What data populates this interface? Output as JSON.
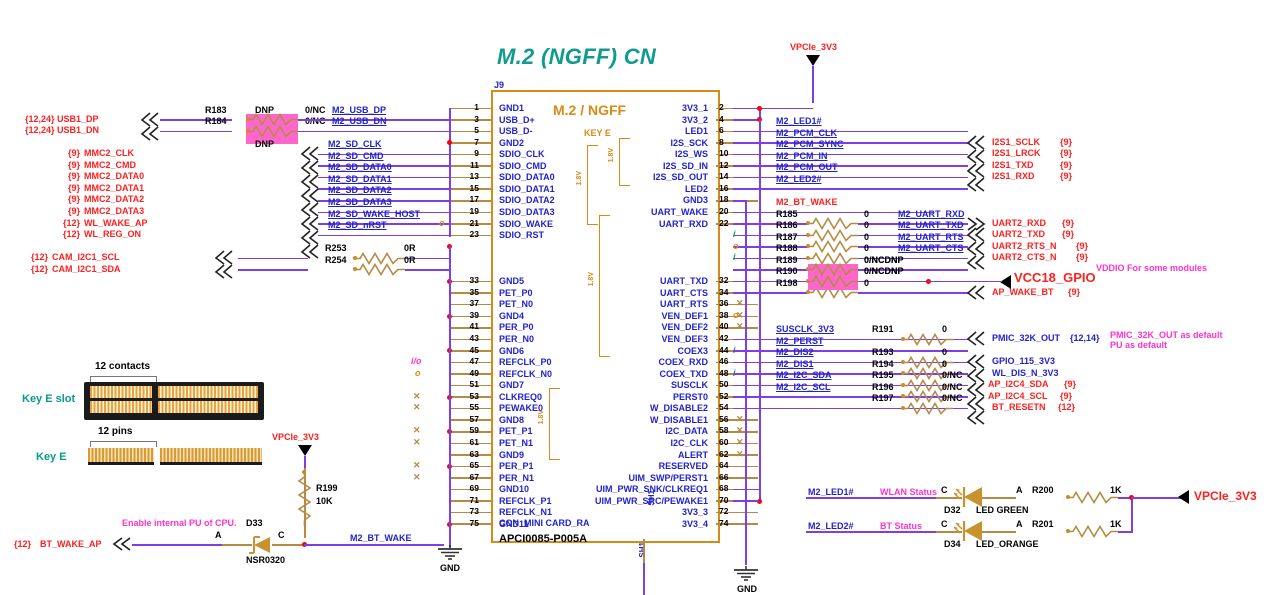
{
  "sheet": {
    "title": "M.2 (NGFF) CN",
    "connector": {
      "refdes": "J9",
      "part_label": "M.2 / NGFF",
      "key_label": "KEY E",
      "footprint": "CON_MINI CARD_RA",
      "mpn": "APCI0085-P005A",
      "shield_label": "SH1",
      "shield_label2": "SH1"
    },
    "voltage_brackets": [
      "1.8V",
      "1.8V",
      "1.8V",
      "1.8V",
      "1.8V"
    ],
    "gnd_label": "GND"
  },
  "left_pins": [
    {
      "num": "1",
      "name": "GND1"
    },
    {
      "num": "3",
      "name": "USB_D+"
    },
    {
      "num": "5",
      "name": "USB_D-"
    },
    {
      "num": "7",
      "name": "GND2"
    },
    {
      "num": "9",
      "name": "SDIO_CLK"
    },
    {
      "num": "11",
      "name": "SDIO_CMD"
    },
    {
      "num": "13",
      "name": "SDIO_DATA0"
    },
    {
      "num": "15",
      "name": "SDIO_DATA1"
    },
    {
      "num": "17",
      "name": "SDIO_DATA2"
    },
    {
      "num": "19",
      "name": "SDIO_DATA3"
    },
    {
      "num": "21",
      "name": "SDIO_WAKE"
    },
    {
      "num": "23",
      "name": "SDIO_RST"
    },
    {
      "num": "33",
      "name": "GND5"
    },
    {
      "num": "35",
      "name": "PET_P0"
    },
    {
      "num": "37",
      "name": "PET_N0"
    },
    {
      "num": "39",
      "name": "GND4"
    },
    {
      "num": "41",
      "name": "PER_P0"
    },
    {
      "num": "43",
      "name": "PER_N0"
    },
    {
      "num": "45",
      "name": "GND6"
    },
    {
      "num": "47",
      "name": "REFCLK_P0"
    },
    {
      "num": "49",
      "name": "REFCLK_N0"
    },
    {
      "num": "51",
      "name": "GND7"
    },
    {
      "num": "53",
      "name": "CLKREQ0"
    },
    {
      "num": "55",
      "name": "PEWAKE0"
    },
    {
      "num": "57",
      "name": "GND8"
    },
    {
      "num": "59",
      "name": "PET_P1"
    },
    {
      "num": "61",
      "name": "PET_N1"
    },
    {
      "num": "63",
      "name": "GND9"
    },
    {
      "num": "65",
      "name": "PER_P1"
    },
    {
      "num": "67",
      "name": "PER_N1"
    },
    {
      "num": "69",
      "name": "GND10"
    },
    {
      "num": "71",
      "name": "REFCLK_P1"
    },
    {
      "num": "73",
      "name": "REFCLK_N1"
    },
    {
      "num": "75",
      "name": "GND11"
    }
  ],
  "right_pins": [
    {
      "num": "2",
      "name": "3V3_1"
    },
    {
      "num": "4",
      "name": "3V3_2"
    },
    {
      "num": "6",
      "name": "LED1"
    },
    {
      "num": "8",
      "name": "I2S_SCK"
    },
    {
      "num": "10",
      "name": "I2S_WS"
    },
    {
      "num": "12",
      "name": "I2S_SD_IN"
    },
    {
      "num": "14",
      "name": "I2S_SD_OUT"
    },
    {
      "num": "16",
      "name": "LED2"
    },
    {
      "num": "18",
      "name": "GND3"
    },
    {
      "num": "20",
      "name": "UART_WAKE"
    },
    {
      "num": "22",
      "name": "UART_RXD"
    },
    {
      "num": "32",
      "name": "UART_TXD"
    },
    {
      "num": "34",
      "name": "UART_CTS"
    },
    {
      "num": "36",
      "name": "UART_RTS"
    },
    {
      "num": "38",
      "name": "VEN_DEF1"
    },
    {
      "num": "40",
      "name": "VEN_DEF2"
    },
    {
      "num": "42",
      "name": "VEN_DEF3"
    },
    {
      "num": "44",
      "name": "COEX3"
    },
    {
      "num": "46",
      "name": "COEX_RXD"
    },
    {
      "num": "48",
      "name": "COEX_TXD"
    },
    {
      "num": "50",
      "name": "SUSCLK"
    },
    {
      "num": "52",
      "name": "PERST0"
    },
    {
      "num": "54",
      "name": "W_DISABLE2"
    },
    {
      "num": "56",
      "name": "W_DISABLE1"
    },
    {
      "num": "58",
      "name": "I2C_DATA"
    },
    {
      "num": "60",
      "name": "I2C_CLK"
    },
    {
      "num": "62",
      "name": "ALERT"
    },
    {
      "num": "64",
      "name": "RESERVED"
    },
    {
      "num": "66",
      "name": "UIM_SWP/PERST1"
    },
    {
      "num": "68",
      "name": "UIM_PWR_SNK/CLKREQ1"
    },
    {
      "num": "70",
      "name": "UIM_PWR_SRC/PEWAKE1"
    },
    {
      "num": "72",
      "name": "3V3_3"
    },
    {
      "num": "74",
      "name": "3V3_4"
    }
  ],
  "left_nets": {
    "usb": [
      {
        "sheet": "{12,24}",
        "name": "USB1_DP"
      },
      {
        "sheet": "{12,24}",
        "name": "USB1_DN"
      }
    ],
    "mmc": [
      {
        "sheet": "{9}",
        "name": "MMC2_CLK"
      },
      {
        "sheet": "{9}",
        "name": "MMC2_CMD"
      },
      {
        "sheet": "{9}",
        "name": "MMC2_DATA0"
      },
      {
        "sheet": "{9}",
        "name": "MMC2_DATA1"
      },
      {
        "sheet": "{9}",
        "name": "MMC2_DATA2"
      },
      {
        "sheet": "{9}",
        "name": "MMC2_DATA3"
      },
      {
        "sheet": "{12}",
        "name": "WL_WAKE_AP"
      },
      {
        "sheet": "{12}",
        "name": "WL_REG_ON"
      }
    ],
    "cam": [
      {
        "sheet": "{12}",
        "name": "CAM_I2C1_SCL"
      },
      {
        "sheet": "{12}",
        "name": "CAM_I2C1_SDA"
      }
    ],
    "bt_wake_ap": {
      "sheet": "{12}",
      "name": "BT_WAKE_AP"
    }
  },
  "left_m2_nets": [
    "M2_USB_DP",
    "M2_USB_DN",
    "M2_SD_CLK",
    "M2_SD_CMD",
    "M2_SD_DATA0",
    "M2_SD_DATA1",
    "M2_SD_DATA2",
    "M2_SD_DATA3",
    "M2_SD_WAKE_HOST",
    "M2_SD_nRST"
  ],
  "left_resistors": [
    {
      "ref": "R183",
      "value": "0/NC",
      "top_note": "DNP",
      "dnp": true
    },
    {
      "ref": "R184",
      "value": "0/NC",
      "bot_note": "DNP",
      "dnp": true
    },
    {
      "ref": "R253",
      "value": "0R",
      "dnp": false
    },
    {
      "ref": "R254",
      "value": "0R",
      "dnp": false
    }
  ],
  "right_m2_nets_top": [
    "M2_LED1#",
    "M2_PCM_CLK",
    "M2_PCM_SYNC",
    "M2_PCM_IN",
    "M2_PCM_OUT",
    "M2_LED2#"
  ],
  "right_nets_i2s": [
    {
      "name": "I2S1_SCLK",
      "sheet": "{9}"
    },
    {
      "name": "I2S1_LRCK",
      "sheet": "{9}"
    },
    {
      "name": "I2S1_TXD",
      "sheet": "{9}"
    },
    {
      "name": "I2S1_RXD",
      "sheet": "{9}"
    }
  ],
  "bt_wake_label": "M2_BT_WAKE",
  "right_resistors": [
    {
      "ref": "R185",
      "value": "0",
      "net": "M2_UART_RXD",
      "dnp": false
    },
    {
      "ref": "R186",
      "value": "0",
      "net": "M2_UART_TXD",
      "dnp": false
    },
    {
      "ref": "R187",
      "value": "0",
      "net": "M2_UART_RTS",
      "dnp": false
    },
    {
      "ref": "R188",
      "value": "0",
      "net": "M2_UART_CTS",
      "dnp": false
    },
    {
      "ref": "R189",
      "value": "0/NCDNP",
      "net": "",
      "dnp": true
    },
    {
      "ref": "R190",
      "value": "0/NCDNP",
      "net": "",
      "dnp": true
    },
    {
      "ref": "R198",
      "value": "0",
      "net": "",
      "dnp": false
    },
    {
      "ref": "R191",
      "value": "0",
      "net": "",
      "dnp": false
    },
    {
      "ref": "R193",
      "value": "0",
      "net": "",
      "dnp": false
    },
    {
      "ref": "R194",
      "value": "0",
      "net": "",
      "dnp": false
    },
    {
      "ref": "R195",
      "value": "0/NC",
      "net": "",
      "dnp": false
    },
    {
      "ref": "R196",
      "value": "0/NC",
      "net": "",
      "dnp": false
    },
    {
      "ref": "R197",
      "value": "0/NC",
      "net": "",
      "dnp": false
    }
  ],
  "right_far_nets": [
    {
      "name": "UART2_RXD",
      "sheet": "{9}",
      "color": "red"
    },
    {
      "name": "UART2_TXD",
      "sheet": "{9}",
      "color": "red"
    },
    {
      "name": "UART2_RTS_N",
      "sheet": "{9}",
      "color": "red"
    },
    {
      "name": "UART2_CTS_N",
      "sheet": "{9}",
      "color": "red"
    },
    {
      "name": "AP_WAKE_BT",
      "sheet": "{9}",
      "color": "red"
    },
    {
      "name": "PMIC_32K_OUT",
      "sheet": "{12,14}",
      "color": "blue"
    },
    {
      "name": "GPIO_115_3V3",
      "sheet": "",
      "color": "blue"
    },
    {
      "name": "WL_DIS_N_3V3",
      "sheet": "",
      "color": "blue"
    },
    {
      "name": "AP_I2C4_SDA",
      "sheet": "{9}",
      "color": "red"
    },
    {
      "name": "AP_I2C4_SCL",
      "sheet": "{9}",
      "color": "red"
    },
    {
      "name": "BT_RESETN",
      "sheet": "{12}",
      "color": "red"
    }
  ],
  "lower_right_m2_nets": [
    "SUSCLK_3V3",
    "M2_PERST",
    "M2_DIS2",
    "M2_DIS1",
    "M2_I2C_SDA",
    "M2_I2C_SCL"
  ],
  "power_rails": [
    {
      "name": "VPCIe_3V3"
    },
    {
      "name": "VCC18_GPIO"
    },
    {
      "name": "VPCIe_3V3"
    },
    {
      "name": "VPCIe_3V3"
    }
  ],
  "notes": [
    {
      "text": "VDDIO For some modules"
    },
    {
      "text": "PMIC_32K_OUT as default"
    },
    {
      "text": "PU as default"
    },
    {
      "text": "Enable internal PU of CPU."
    }
  ],
  "keye_figure": {
    "contacts_label": "12 contacts",
    "slot_label": "Key E slot",
    "pins_label": "12 pins",
    "key_label": "Key E"
  },
  "pullup": {
    "ref": "R199",
    "value": "10K"
  },
  "diode": {
    "ref": "D33",
    "mpn": "NSR0320",
    "anode": "A",
    "cathode": "C"
  },
  "leds": [
    {
      "net": "M2_LED1#",
      "status": "WLAN Status",
      "cathode": "C",
      "anode": "A",
      "ref": "D32",
      "type": "LED GREEN",
      "res_ref": "R200",
      "res_val": "1K"
    },
    {
      "net": "M2_LED2#",
      "status": "BT Status",
      "cathode": "C",
      "anode": "A",
      "ref": "D34",
      "type": "LED_ORANGE",
      "res_ref": "R201",
      "res_val": "1K"
    }
  ],
  "colors": {
    "wire_net": "#7b3fe4",
    "wire_pin": "#b58b43",
    "title": "#0f9c8e",
    "net_red": "#ff2020",
    "net_blue": "#2222cc",
    "note_magenta": "#ff33cc",
    "dnp_highlight": "#ff66cc",
    "junction": "#ff0000"
  }
}
